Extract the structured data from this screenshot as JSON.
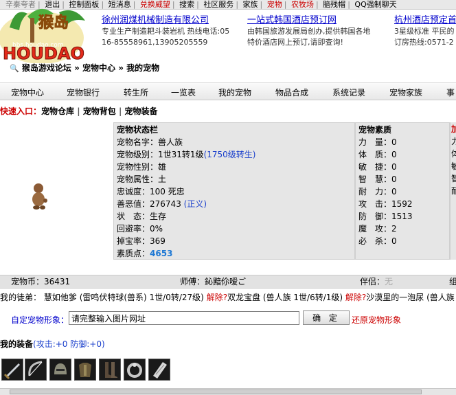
{
  "topnav": {
    "items": [
      "辛秦夸者",
      "退出",
      "控制面板",
      "短消息",
      "兑换威望",
      "搜索",
      "社区服务",
      "家族",
      "宠物",
      "农牧场",
      "脑残帽",
      "QQ强制聊天"
    ],
    "highlight": [
      "兑换威望",
      "宠物",
      "农牧场"
    ]
  },
  "logo": {
    "text": "HOUDAO",
    "chinese": "猴岛",
    "url": "bbs.houdao.com"
  },
  "ads": [
    {
      "title": "徐州润煤机械制造有限公司",
      "line1": "专业生产制造耙斗装岩机 热线电话:05",
      "line2": "16-85558961,13905205559"
    },
    {
      "title": "一站式韩国酒店预订网",
      "line1": "由韩国旅游发展局创办,提供韩国各地",
      "line2": "特价酒店网上预订,请即查询!"
    },
    {
      "title": "杭州酒店预定首",
      "line1": "3星级标准 平民的",
      "line2": "订房热线:0571-2"
    }
  ],
  "breadcrumb": [
    "猴岛游戏论坛",
    "宠物中心",
    "我的宠物"
  ],
  "menu": [
    "宠物中心",
    "宠物银行",
    "转生所",
    "一览表",
    "我的宠物",
    "物品合成",
    "系统记录",
    "宠物家族",
    "事"
  ],
  "quick": {
    "label": "快速入口：",
    "links": [
      "宠物仓库",
      "宠物背包",
      "宠物装备"
    ]
  },
  "status": {
    "title": "宠物状态栏",
    "name_label": "宠物名字：",
    "name": "兽人族",
    "level_label": "宠物级别：",
    "level": "1世31转1级",
    "level_note": "(1750级转生)",
    "gender_label": "宠物性别：",
    "gender": "雄",
    "element_label": "宠物属性：",
    "element": "土",
    "loyalty_label": "忠诚度：",
    "loyalty": "100 死忠",
    "karma_label": "善恶值：",
    "karma": "276743",
    "karma_note": "(正义)",
    "state_label": "状　态：",
    "state": "生存",
    "evade_label": "回避率：",
    "evade": "0%",
    "drop_label": "掉宝率：",
    "drop": "369",
    "points_label": "素质点：",
    "points": "4653"
  },
  "attributes": {
    "title": "宠物素质",
    "rows": [
      {
        "label": "力　量：",
        "value": "0"
      },
      {
        "label": "体　质：",
        "value": "0"
      },
      {
        "label": "敏　捷：",
        "value": "0"
      },
      {
        "label": "智　慧：",
        "value": "0"
      },
      {
        "label": "耐　力：",
        "value": "0"
      },
      {
        "label": "攻　击：",
        "value": "1592"
      },
      {
        "label": "防　御：",
        "value": "1513"
      },
      {
        "label": "魔　攻：",
        "value": "2"
      },
      {
        "label": "必　杀：",
        "value": "0"
      }
    ]
  },
  "right_cut": [
    "加",
    "力",
    "体",
    "敏",
    "智",
    "耐"
  ],
  "coinbar": {
    "coin_label": "宠物币：",
    "coin": "36431",
    "master_label": "师傅：",
    "master": "鈊黯伱嗳ご",
    "partner_label": "伴侣：",
    "partner": "无",
    "cut": "组"
  },
  "apprentice": {
    "label": "我的徒弟：",
    "entries": [
      {
        "name": "慧如他爹",
        "info": "(雷鸣伏特球(兽系) 1世/0转/27级)",
        "action": "解除?"
      },
      {
        "name": "双龙宝盘",
        "info": "(兽人族 1世/6转/1级)",
        "action": "解除?"
      },
      {
        "name": "沙漠里的一泡尿",
        "info": "(兽人族",
        "action": ""
      }
    ]
  },
  "custom": {
    "label": "自定宠物形象：",
    "input_value": "请完整输入图片网址",
    "ok": "确 定",
    "restore": "还原宠物形象"
  },
  "equipment": {
    "title": "我的装备",
    "stats": "(攻击:+0 防御:+0)",
    "icons": [
      "sword-icon",
      "bow-icon",
      "helmet-icon",
      "armor-icon",
      "boots-icon",
      "ring-icon",
      "shield-icon"
    ]
  },
  "colors": {
    "link": "#0000cc",
    "red": "#cc0000",
    "panel": "#e6e6e6",
    "highlight_blue": "#1e78d4"
  }
}
